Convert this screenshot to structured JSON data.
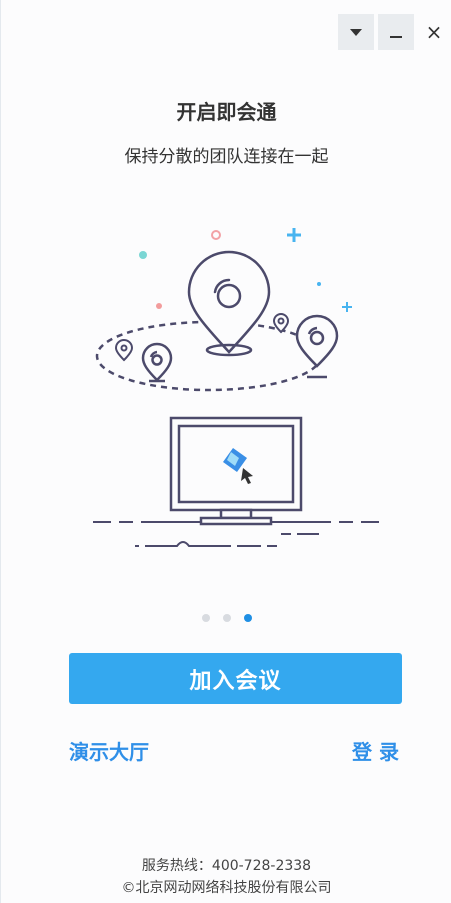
{
  "window": {
    "buttons": [
      {
        "name": "dropdown",
        "icon": "caret-down-icon"
      },
      {
        "name": "minimize",
        "icon": "minimize-icon"
      },
      {
        "name": "close",
        "icon": "close-icon",
        "label": "×"
      }
    ]
  },
  "onboarding": {
    "title": "开启即会通",
    "subtitle": "保持分散的团队连接在一起",
    "page_index": 3,
    "page_count": 3
  },
  "actions": {
    "join_label": "加入会议",
    "demo_label": "演示大厅",
    "login_label": "登 录"
  },
  "footer": {
    "hotline": "服务热线：400-728-2338",
    "copyright": "©北京网动网络科技股份有限公司"
  },
  "colors": {
    "accent": "#34a8ef",
    "link": "#2f8fe8",
    "active_dot": "#1f8fe4",
    "illustration_line": "#4c4a6b"
  }
}
